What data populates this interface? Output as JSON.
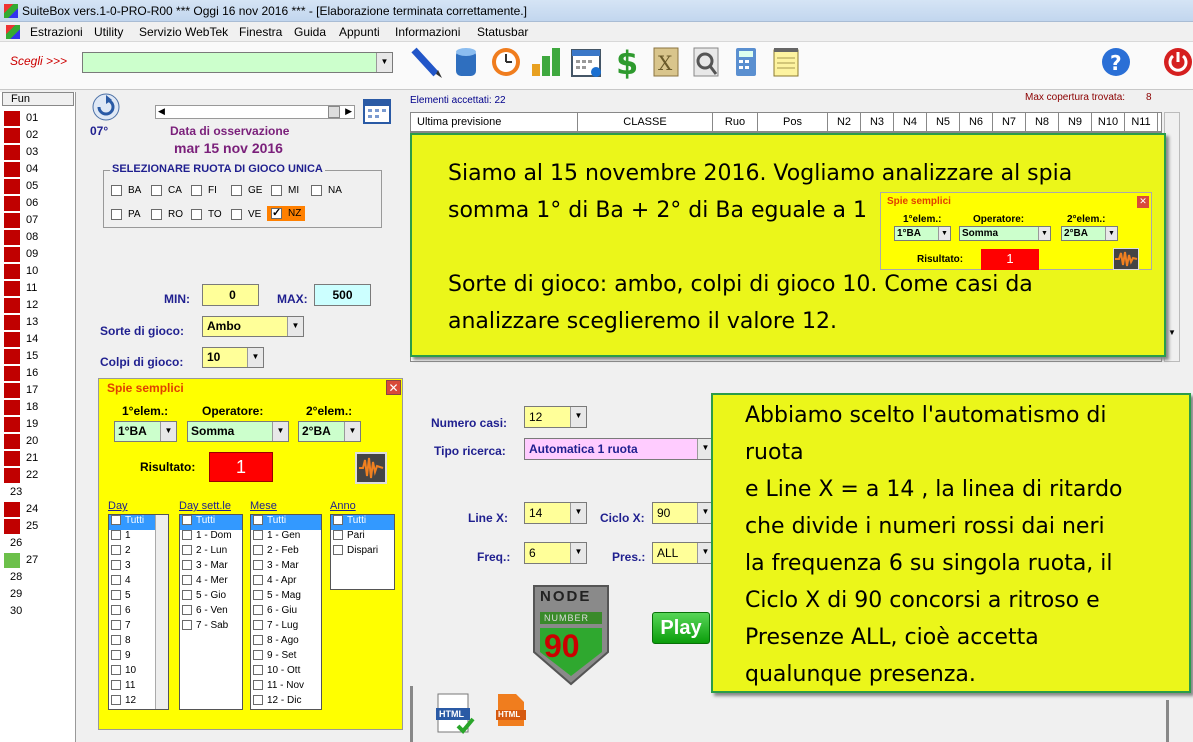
{
  "window": {
    "title": "SuiteBox vers.1-0-PRO-R00  ***  Oggi 16 nov 2016  ***  - [Elaborazione terminata correttamente.]"
  },
  "menu": [
    "Estrazioni",
    "Utility",
    "Servizio WebTek",
    "Finestra",
    "Guida",
    "Appunti",
    "Informazioni",
    "Statusbar"
  ],
  "toolbar": {
    "scegli_label": "Scegli >>>",
    "scegli_value": "",
    "icons": [
      "pencil-icon",
      "database-icon",
      "clock-icon",
      "bar-chart-icon",
      "calendar-icon",
      "dollar-icon",
      "file-x-icon",
      "magnifier-icon",
      "calculator-icon",
      "notepad-icon",
      "help-icon",
      "power-icon"
    ]
  },
  "left_list": {
    "header": "Fun",
    "rows": [
      {
        "n": "01",
        "c": "#c00000"
      },
      {
        "n": "02",
        "c": "#c00000"
      },
      {
        "n": "03",
        "c": "#c00000"
      },
      {
        "n": "04",
        "c": "#c00000"
      },
      {
        "n": "05",
        "c": "#c00000"
      },
      {
        "n": "06",
        "c": "#c00000"
      },
      {
        "n": "07",
        "c": "#c00000"
      },
      {
        "n": "08",
        "c": "#c00000"
      },
      {
        "n": "09",
        "c": "#c00000"
      },
      {
        "n": "10",
        "c": "#c00000"
      },
      {
        "n": "11",
        "c": "#c00000"
      },
      {
        "n": "12",
        "c": "#c00000"
      },
      {
        "n": "13",
        "c": "#c00000"
      },
      {
        "n": "14",
        "c": "#c00000"
      },
      {
        "n": "15",
        "c": "#c00000"
      },
      {
        "n": "16",
        "c": "#c00000"
      },
      {
        "n": "17",
        "c": "#c00000"
      },
      {
        "n": "18",
        "c": "#c00000"
      },
      {
        "n": "19",
        "c": "#c00000"
      },
      {
        "n": "20",
        "c": "#c00000"
      },
      {
        "n": "21",
        "c": "#c00000"
      },
      {
        "n": "22",
        "c": "#c00000"
      },
      {
        "n": "23",
        "c": ""
      },
      {
        "n": "24",
        "c": "#c00000"
      },
      {
        "n": "25",
        "c": "#c00000"
      },
      {
        "n": "26",
        "c": ""
      },
      {
        "n": "27",
        "c": "#6cc04a"
      },
      {
        "n": "28",
        "c": ""
      },
      {
        "n": "29",
        "c": ""
      },
      {
        "n": "30",
        "c": ""
      }
    ]
  },
  "observation": {
    "temp": "07°",
    "label": "Data di osservazione",
    "date": "mar 15 nov 2016"
  },
  "ruota": {
    "title": "SELEZIONARE RUOTA DI GIOCO UNICA",
    "row1": [
      "BA",
      "CA",
      "FI",
      "GE",
      "MI",
      "NA"
    ],
    "row2": [
      "PA",
      "RO",
      "TO",
      "VE",
      "NZ"
    ],
    "selected": "NZ"
  },
  "params": {
    "min_label": "MIN:",
    "min": "0",
    "max_label": "MAX:",
    "max": "500",
    "sorte_label": "Sorte di gioco:",
    "sorte": "Ambo",
    "colpi_label": "Colpi di gioco:",
    "colpi": "10"
  },
  "spie": {
    "title": "Spie semplici",
    "elem1_label": "1°elem.:",
    "op_label": "Operatore:",
    "elem2_label": "2°elem.:",
    "elem1": "1°BA",
    "op": "Somma",
    "elem2": "2°BA",
    "result_label": "Risultato:",
    "result": "1",
    "lists": [
      {
        "title": "Day",
        "items": [
          "Tutti",
          "1",
          "2",
          "3",
          "4",
          "5",
          "6",
          "7",
          "8",
          "9",
          "10",
          "11",
          "12"
        ]
      },
      {
        "title": "Day sett.le",
        "items": [
          "Tutti",
          "1 - Dom",
          "2 - Lun",
          "3 - Mar",
          "4 - Mer",
          "5 - Gio",
          "6 - Ven",
          "7 - Sab"
        ]
      },
      {
        "title": "Mese",
        "items": [
          "Tutti",
          "1 - Gen",
          "2 - Feb",
          "3 - Mar",
          "4 - Apr",
          "5 - Mag",
          "6 - Giu",
          "7 - Lug",
          "8 - Ago",
          "9 - Set",
          "10 - Ott",
          "11 - Nov",
          "12 - Dic"
        ]
      },
      {
        "title": "Anno",
        "items": [
          "Tutti",
          "Pari",
          "Dispari"
        ]
      }
    ]
  },
  "grid": {
    "elementi": "Elementi accettati: 22",
    "max_cop_label": "Max copertura trovata:",
    "max_cop": "8",
    "cols": [
      "Ultima previsione",
      "CLASSE",
      "Ruo",
      "Pos",
      "N2",
      "N3",
      "N4",
      "N5",
      "N6",
      "N7",
      "N8",
      "N9",
      "N10",
      "N11"
    ]
  },
  "search": {
    "numero_label": "Numero casi:",
    "numero": "12",
    "tipo_label": "Tipo ricerca:",
    "tipo": "Automatica 1 ruota",
    "linex_label": "Line X:",
    "linex": "14",
    "ciclo_label": "Ciclo X:",
    "ciclo": "90",
    "freq_label": "Freq.:",
    "freq": "6",
    "pres_label": "Pres.:",
    "pres": "ALL",
    "logo_top": "NODE",
    "logo_mid": "NUMBER",
    "logo_num": "90",
    "play": "Play"
  },
  "note1": {
    "lines": [
      "Siamo al 15 novembre 2016. Vogliamo analizzare al spia",
      "somma 1° di Ba + 2° di Ba eguale a 1",
      "",
      "Sorte di gioco: ambo, colpi di gioco 10. Come casi da",
      "analizzare sceglieremo il valore 12."
    ]
  },
  "note2": {
    "lines": [
      "Abbiamo scelto l'automatismo di",
      "ruota",
      "e Line X = a 14 , la linea di ritardo",
      "che divide i numeri rossi dai neri",
      "la frequenza 6 su singola ruota, il",
      "Ciclo X di 90 concorsi a ritroso e",
      "Presenze ALL, cioè accetta",
      "qualunque presenza."
    ]
  },
  "html_icons": [
    "HTML",
    "HTML"
  ]
}
